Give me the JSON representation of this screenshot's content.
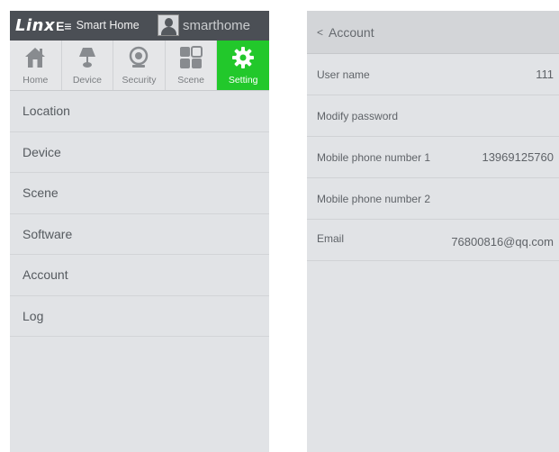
{
  "left": {
    "header": {
      "logo_text": "Linx",
      "logo_mark": "E≡",
      "app_title": "Smart Home",
      "username": "smarthome"
    },
    "tabs": [
      {
        "label": "Home",
        "icon": "house-icon"
      },
      {
        "label": "Device",
        "icon": "lamp-icon"
      },
      {
        "label": "Security",
        "icon": "camera-icon"
      },
      {
        "label": "Scene",
        "icon": "grid-icon"
      },
      {
        "label": "Setting",
        "icon": "gear-icon",
        "active": true
      }
    ],
    "menu": [
      "Location",
      "Device",
      "Scene",
      "Software",
      "Account",
      "Log"
    ]
  },
  "right": {
    "back_label": "<",
    "title": "Account",
    "rows": [
      {
        "label": "User name",
        "value": "111"
      },
      {
        "label": "Modify password",
        "value": ""
      },
      {
        "label": "Mobile phone number 1",
        "value": "13969125760"
      },
      {
        "label": "Mobile phone number 2",
        "value": ""
      },
      {
        "label": "Email",
        "value": "76800816@qq.com"
      }
    ]
  },
  "colors": {
    "topbar": "#4b4f55",
    "active_tab": "#22c82b",
    "panel_bg": "#e1e3e6"
  }
}
